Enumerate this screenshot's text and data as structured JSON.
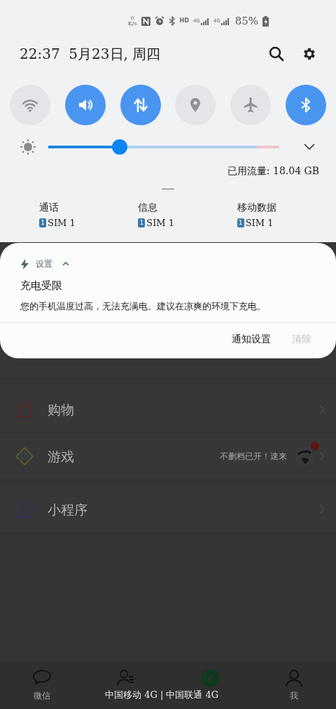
{
  "status_bar": {
    "net_speed": "0",
    "net_unit": "K/s",
    "hd": "HD",
    "network_1": "4G",
    "network_2": "4G",
    "battery": "85%"
  },
  "header": {
    "datetime": "22:37  5月23日, 周四"
  },
  "quick_toggles": [
    {
      "kind": "wifi",
      "on": false
    },
    {
      "kind": "sound",
      "on": true
    },
    {
      "kind": "data",
      "on": true
    },
    {
      "kind": "location",
      "on": false
    },
    {
      "kind": "airplane",
      "on": false
    },
    {
      "kind": "bluetooth",
      "on": true
    }
  ],
  "brightness": {
    "level": 0.31
  },
  "data_usage": "已用流量: 18.04 GB",
  "sim_settings": [
    {
      "label": "通话",
      "sim_badge": "1",
      "sim": "SIM 1"
    },
    {
      "label": "信息",
      "sim_badge": "1",
      "sim": "SIM 1"
    },
    {
      "label": "移动数据",
      "sim_badge": "1",
      "sim": "SIM 1"
    }
  ],
  "notification": {
    "app": "设置",
    "expanded": true,
    "title": "充电受限",
    "body": "您的手机温度过高，无法充满电。建议在凉爽的环境下充电。",
    "actions": [
      {
        "label": "通知设置",
        "disabled": false
      },
      {
        "label": "清除",
        "disabled": true
      }
    ]
  },
  "background_app": {
    "rows": [
      {
        "kind": "shopping",
        "label": "购物",
        "badge": false
      },
      {
        "kind": "games",
        "label": "游戏",
        "promo": "不删档已开！速来",
        "badge": true
      },
      {
        "kind": "mini_programs",
        "label": "小程序",
        "badge": false
      }
    ],
    "tabs": [
      {
        "kind": "chats",
        "label": "微信",
        "selected": false
      },
      {
        "kind": "contacts",
        "selected": false
      },
      {
        "kind": "discover",
        "selected": true
      },
      {
        "kind": "me",
        "label": "我",
        "selected": false
      }
    ]
  },
  "carrier": "中国移动 4G | 中国联通 4G"
}
